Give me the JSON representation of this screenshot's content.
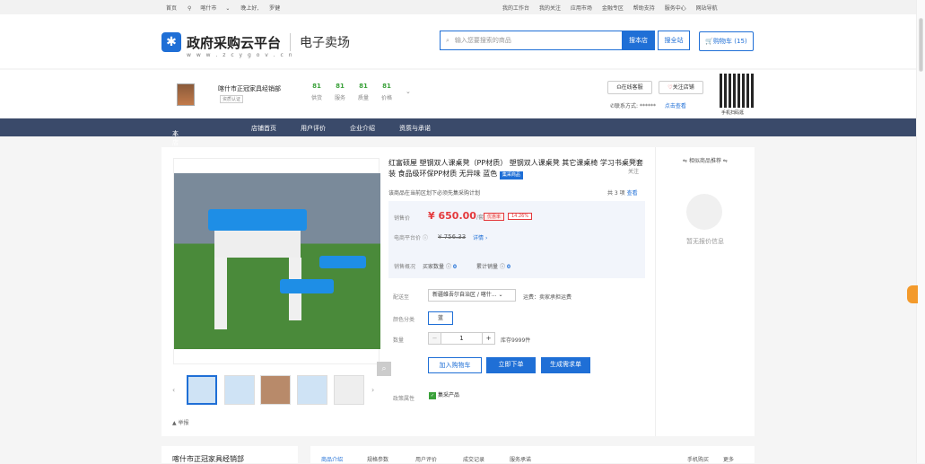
{
  "topbar": {
    "home": "首页",
    "location": "喀什市",
    "greeting": "晚上好,",
    "user": "罗健",
    "right": [
      "我的工作台",
      "我的关注",
      "应用市场",
      "金融专区",
      "帮助支持",
      "服务中心",
      "网站导航"
    ]
  },
  "header": {
    "logo": "政府采购云平台",
    "logo_sub": "w w w . z c y g o v . c n",
    "mall": "电子卖场",
    "search_placeholder": "输入您要搜索的商品",
    "search_store": "搜本店",
    "search_all": "搜全站",
    "cart": "购物车 (15)"
  },
  "store": {
    "name": "喀什市正冠家具经销部",
    "tag": "资质认证",
    "scores": [
      {
        "n": "81",
        "t": "供货"
      },
      {
        "n": "81",
        "t": "服务"
      },
      {
        "n": "81",
        "t": "质量"
      },
      {
        "n": "81",
        "t": "价格"
      }
    ],
    "online": "在线客服",
    "follow": "关注店铺",
    "contact_label": "联系方式:",
    "contact_value": "******",
    "contact_link": "点击查看",
    "qr_label": "手机扫码逛"
  },
  "nav": [
    "本店所有商品",
    "店铺首页",
    "用户评价",
    "企业介绍",
    "资质与承诺"
  ],
  "product": {
    "title": "红富硕屋 塑钢双人课桌凳（PP材质） 塑钢双人课桌凳 其它课桌椅 学习书桌凳套装 食品级环保PP材质 无异味 蓝色",
    "badge": "集采商品",
    "fav": "关注",
    "notice": "该商品在当前区划下必须先集采购计划",
    "total": "共 3 项",
    "total_link": "查看",
    "price_label": "销售价",
    "price": "¥ 650.00",
    "price_unit": "/套",
    "price_tag": "优惠率",
    "price_pct": "14.26%",
    "platform_label": "电商平台价",
    "platform_price": "¥ 756.33",
    "platform_link": "详情",
    "sales_label": "销售概况",
    "buy_count_label": "买家数量",
    "buy_count": "0",
    "sales_count_label": "累计销量",
    "sales_count": "0",
    "deliver_label": "配送至",
    "deliver_value": "新疆维吾尔自治区 / 喀什...",
    "freight": "运费：卖家承担运费",
    "color_label": "颜色分类",
    "color_value": "蓝",
    "qty_label": "数量",
    "qty_value": "1",
    "stock": "库存9999件",
    "add_cart": "加入购物车",
    "buy_now": "立即下单",
    "demand": "生成需求单",
    "policy_label": "政策属性",
    "policy_value": "集采产品",
    "report": "举报"
  },
  "side": {
    "header": "相似商品推荐",
    "empty": "暂无报价信息"
  },
  "bottom": {
    "store": "喀什市正冠家具经销部",
    "tabs": [
      "商品介绍",
      "规格参数",
      "用户评价",
      "成交记录",
      "服务承诺"
    ],
    "mobile": "手机购买",
    "more": "更多"
  }
}
